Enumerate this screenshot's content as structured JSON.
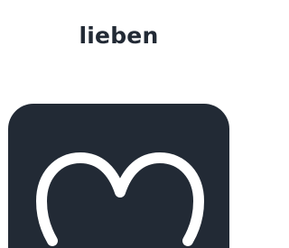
{
  "word": "lieben",
  "icon": {
    "name": "heart-icon",
    "tile_color": "#222a35",
    "stroke_color": "#ffffff"
  }
}
